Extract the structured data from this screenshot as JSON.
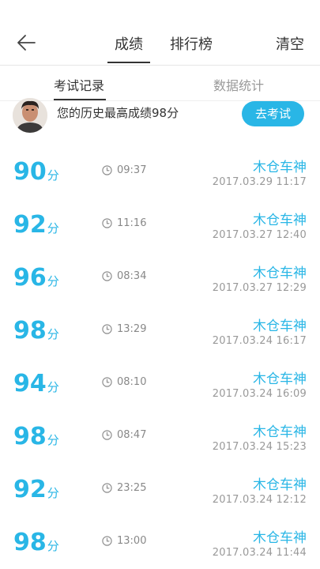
{
  "header": {
    "tabs": [
      {
        "label": "成绩",
        "active": true
      },
      {
        "label": "排行榜",
        "active": false
      }
    ],
    "clear_label": "清空"
  },
  "subtabs": [
    {
      "label": "考试记录",
      "active": true
    },
    {
      "label": "数据统计",
      "active": false
    }
  ],
  "best": {
    "text": "您的历史最高成绩98分",
    "button_label": "去考试"
  },
  "records": [
    {
      "score": "90",
      "unit": "分",
      "duration": "09:37",
      "title": "木仓车神",
      "datetime": "2017.03.29  11:17"
    },
    {
      "score": "92",
      "unit": "分",
      "duration": "11:16",
      "title": "木仓车神",
      "datetime": "2017.03.27  12:40"
    },
    {
      "score": "96",
      "unit": "分",
      "duration": "08:34",
      "title": "木仓车神",
      "datetime": "2017.03.27  12:29"
    },
    {
      "score": "98",
      "unit": "分",
      "duration": "13:29",
      "title": "木仓车神",
      "datetime": "2017.03.24  16:17"
    },
    {
      "score": "94",
      "unit": "分",
      "duration": "08:10",
      "title": "木仓车神",
      "datetime": "2017.03.24  16:09"
    },
    {
      "score": "98",
      "unit": "分",
      "duration": "08:47",
      "title": "木仓车神",
      "datetime": "2017.03.24  15:23"
    },
    {
      "score": "92",
      "unit": "分",
      "duration": "23:25",
      "title": "木仓车神",
      "datetime": "2017.03.24  12:12"
    },
    {
      "score": "98",
      "unit": "分",
      "duration": "13:00",
      "title": "木仓车神",
      "datetime": "2017.03.24  11:44"
    }
  ],
  "colors": {
    "accent": "#29b6e6"
  },
  "icons": {
    "back": "back-arrow-icon",
    "clock": "clock-icon"
  }
}
